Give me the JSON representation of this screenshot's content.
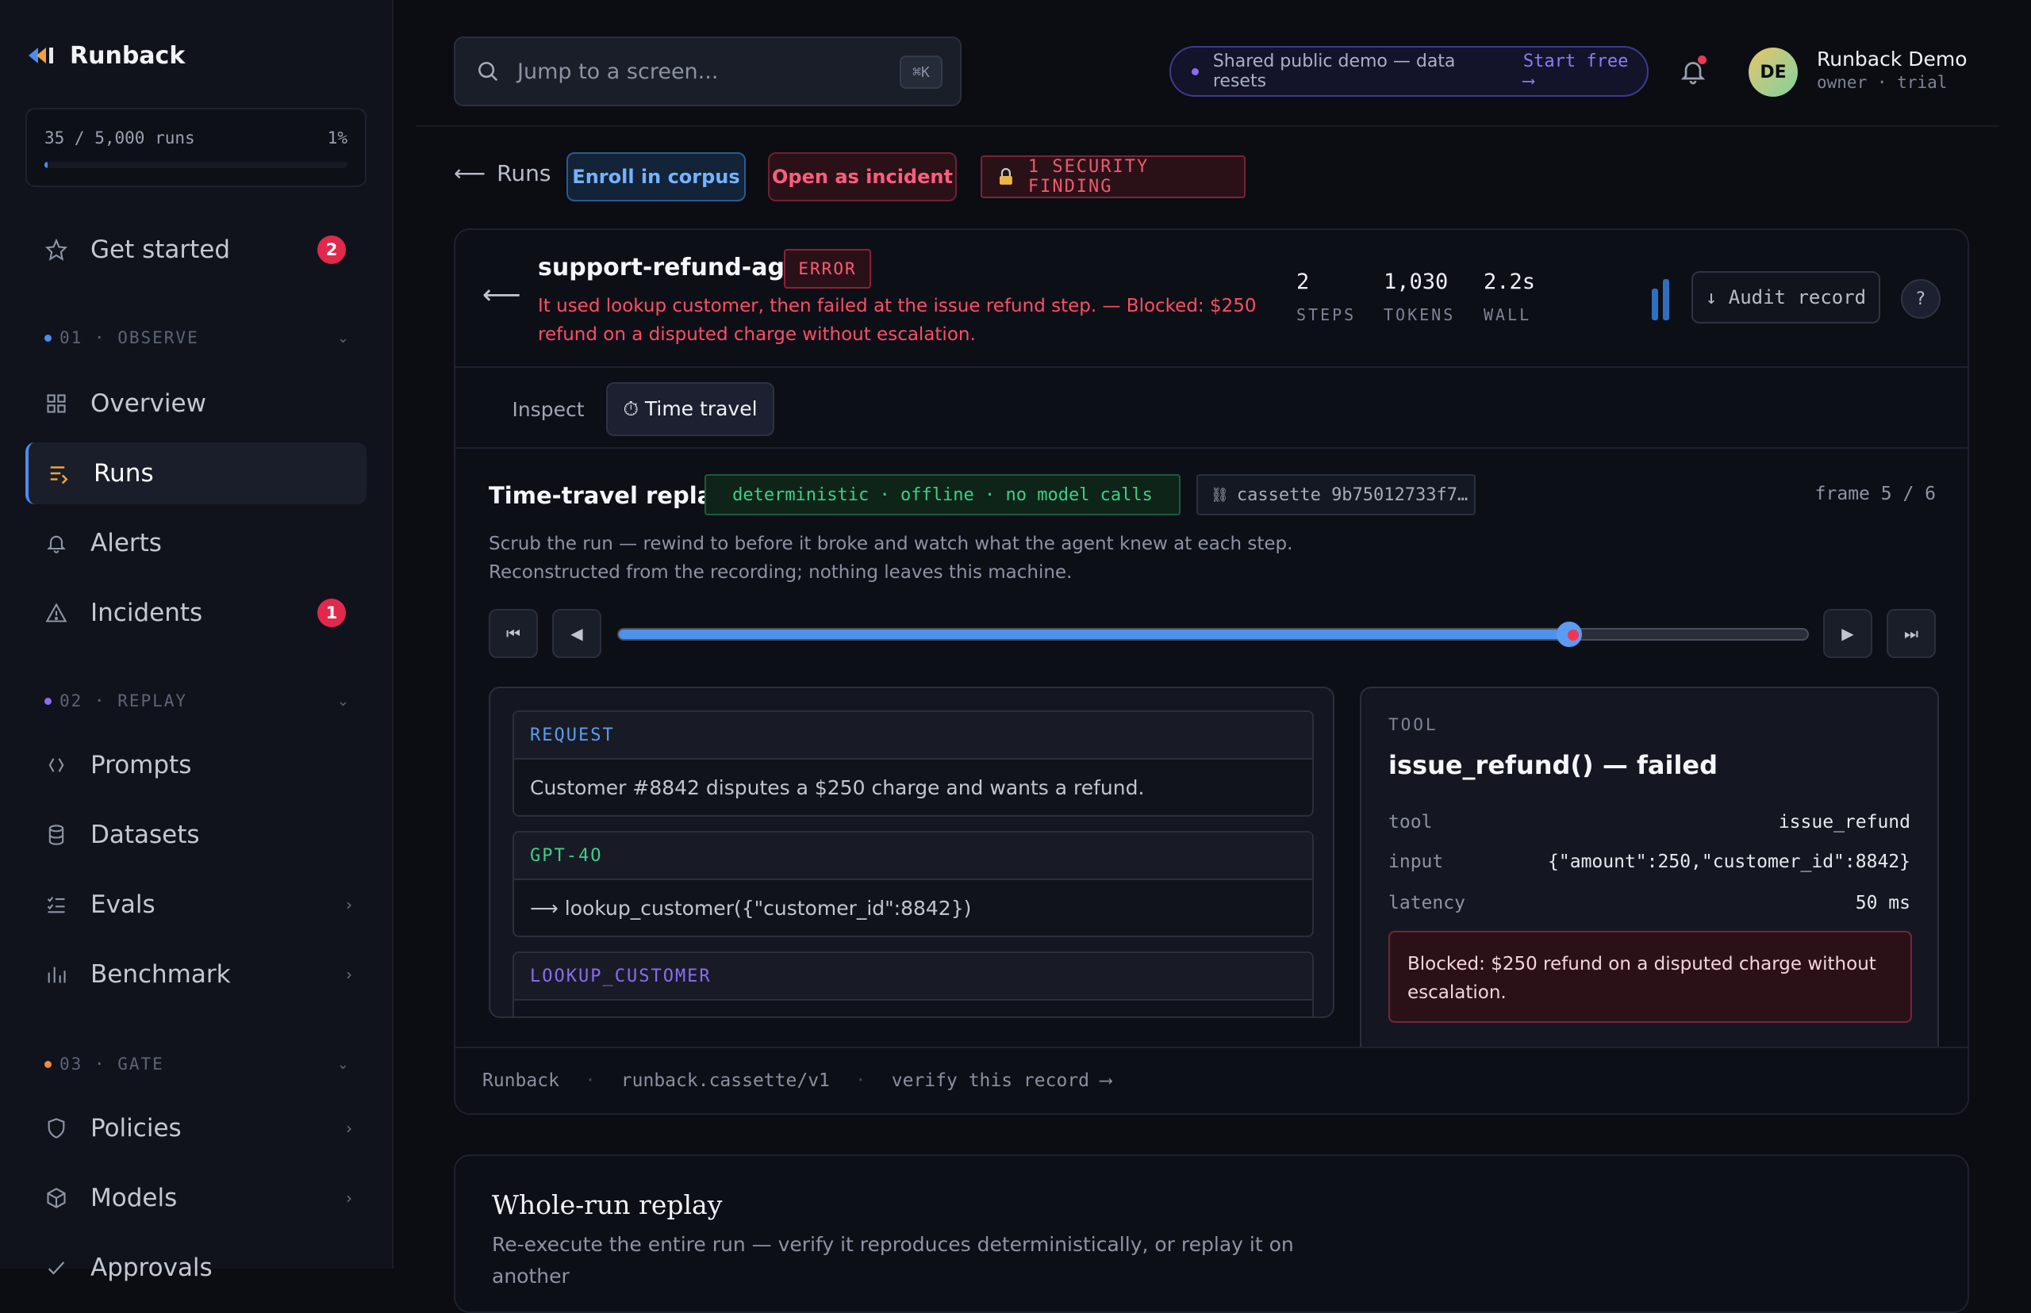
{
  "app": {
    "name": "Runback"
  },
  "quota": {
    "text": "35 / 5,000 runs",
    "pct": "1%",
    "fraction": 0.007
  },
  "sidebar": {
    "get_started": {
      "label": "Get started",
      "badge": "2"
    },
    "sections": [
      {
        "label": "01 · OBSERVE",
        "color": "#4b8cf0"
      },
      {
        "label": "02 · REPLAY",
        "color": "#8a6cf5"
      },
      {
        "label": "03 · GATE",
        "color": "#f08a3c"
      }
    ],
    "items": [
      {
        "label": "Overview",
        "icon": "grid-icon"
      },
      {
        "label": "Runs",
        "icon": "runs-icon"
      },
      {
        "label": "Alerts",
        "icon": "bell-icon"
      },
      {
        "label": "Incidents",
        "icon": "warning-icon",
        "badge": "1"
      },
      {
        "label": "Prompts",
        "icon": "code-icon"
      },
      {
        "label": "Datasets",
        "icon": "database-icon"
      },
      {
        "label": "Evals",
        "icon": "checklist-icon"
      },
      {
        "label": "Benchmark",
        "icon": "bar-chart-icon"
      },
      {
        "label": "Policies",
        "icon": "shield-icon"
      },
      {
        "label": "Models",
        "icon": "cube-icon"
      },
      {
        "label": "Approvals",
        "icon": "check-icon"
      }
    ]
  },
  "search": {
    "placeholder": "Jump to a screen...",
    "shortcut": "⌘K"
  },
  "demo": {
    "text": "Shared public demo — data resets",
    "cta": "Start free ⟶"
  },
  "user": {
    "initials": "DE",
    "name": "Runback Demo",
    "role": "owner · trial"
  },
  "actions": {
    "back": "Runs",
    "enroll": "Enroll in corpus",
    "incident": "Open as incident",
    "security": "1 SECURITY FINDING"
  },
  "run": {
    "name": "support-refund-agent",
    "status": "ERROR",
    "description": "It used lookup customer, then failed at the issue refund step. — Blocked: $250 refund on a disputed charge without escalation.",
    "stats": [
      {
        "value": "2",
        "label": "STEPS"
      },
      {
        "value": "1,030",
        "label": "TOKENS"
      },
      {
        "value": "2.2s",
        "label": "WALL"
      }
    ],
    "audit": "↓ Audit record",
    "help": "?"
  },
  "tabs": [
    {
      "label": "Inspect"
    },
    {
      "label": "⏱ Time travel"
    }
  ],
  "timetravel": {
    "title": "Time-travel replay",
    "badge": "deterministic · offline · no model calls",
    "cassette": "cassette 9b75012733f7…",
    "frame": "frame 5 / 6",
    "desc1": "Scrub the run — rewind to before it broke and watch what the agent knew at each step.",
    "desc2": "Reconstructed from the recording; nothing leaves this machine.",
    "progress": 0.8
  },
  "messages": [
    {
      "role": "REQUEST",
      "color": "#5b9cf0",
      "text": "Customer #8842 disputes a $250 charge and wants a refund."
    },
    {
      "role": "GPT-4O",
      "color": "#3fcf84",
      "text": "⟶ lookup_customer({\"customer_id\":8842})"
    },
    {
      "role": "LOOKUP_CUSTOMER",
      "color": "#8a6cf5",
      "text": ""
    }
  ],
  "tool": {
    "label": "TOOL",
    "title": "issue_refund() — failed",
    "rows": [
      {
        "key": "tool",
        "value": "issue_refund"
      },
      {
        "key": "input",
        "value": "{\"amount\":250,\"customer_id\":8842}"
      },
      {
        "key": "latency",
        "value": "50 ms"
      }
    ],
    "blocked": "Blocked: $250 refund on a disputed charge without escalation."
  },
  "footer": {
    "brand": "Runback",
    "spec": "runback.cassette/v1",
    "verify": "verify this record ⟶"
  },
  "whole": {
    "title": "Whole-run replay",
    "desc": "Re-execute the entire run — verify it reproduces deterministically, or replay it on another"
  }
}
